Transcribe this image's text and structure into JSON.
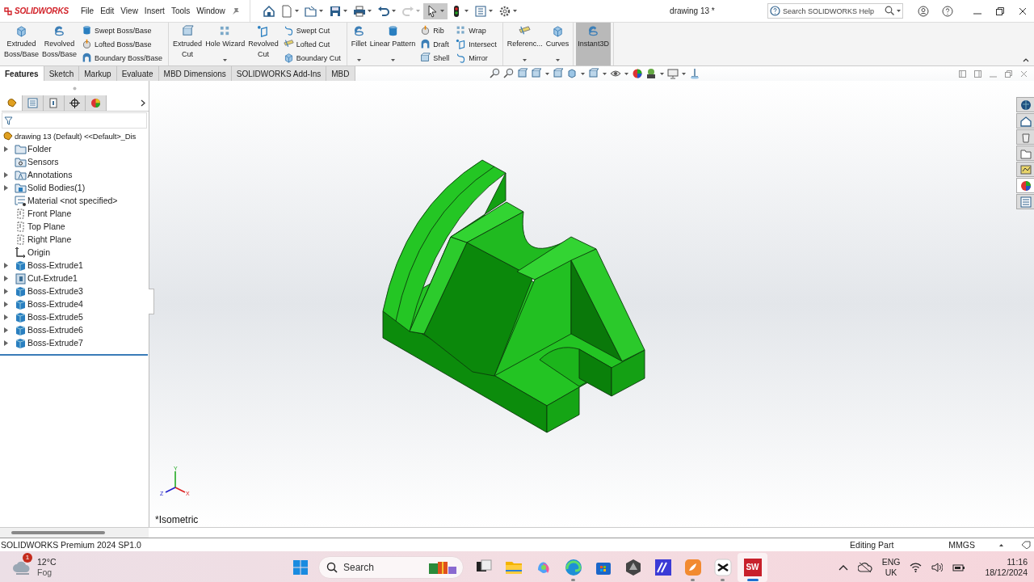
{
  "app": {
    "logo": "SOLIDWORKS",
    "menus": [
      "File",
      "Edit",
      "View",
      "Insert",
      "Tools",
      "Window"
    ],
    "title": "drawing 13 *",
    "search": {
      "placeholder": "Search SOLIDWORKS Help"
    }
  },
  "quick_toolbar": [
    {
      "selected": false,
      "disabled": false
    },
    {
      "selected": false,
      "disabled": false
    },
    {
      "selected": false,
      "disabled": false
    },
    {
      "selected": false,
      "disabled": false
    },
    {
      "selected": false,
      "disabled": false
    },
    {
      "selected": false,
      "disabled": false
    },
    {
      "selected": false,
      "disabled": true
    },
    {
      "selected": true,
      "disabled": false
    },
    {
      "selected": false,
      "disabled": false
    },
    {
      "selected": false,
      "disabled": false
    },
    {
      "selected": false,
      "disabled": false
    }
  ],
  "ribbon": {
    "groups": [
      {
        "items": [
          {
            "kind": "large",
            "label": "Extruded Boss/Base",
            "dropdown": false,
            "on": false
          },
          {
            "kind": "large",
            "label": "Revolved Boss/Base",
            "dropdown": false,
            "on": false
          },
          {
            "kind": "stack",
            "items": [
              "Swept Boss/Base",
              "Lofted Boss/Base",
              "Boundary Boss/Base"
            ]
          }
        ]
      },
      {
        "items": [
          {
            "kind": "large",
            "label": "Extruded Cut",
            "dropdown": false,
            "on": false
          },
          {
            "kind": "large",
            "label": "Hole Wizard",
            "dropdown": true,
            "on": false
          },
          {
            "kind": "large",
            "label": "Revolved Cut",
            "dropdown": false,
            "on": false
          },
          {
            "kind": "stack",
            "items": [
              "Swept Cut",
              "Lofted Cut",
              "Boundary Cut"
            ]
          }
        ]
      },
      {
        "items": [
          {
            "kind": "large",
            "label": "Fillet",
            "dropdown": true,
            "on": false
          },
          {
            "kind": "large",
            "label": "Linear Pattern",
            "dropdown": true,
            "on": false
          },
          {
            "kind": "stack",
            "items": [
              "Rib",
              "Draft",
              "Shell"
            ]
          },
          {
            "kind": "stack",
            "items": [
              "Wrap",
              "Intersect",
              "Mirror"
            ]
          }
        ]
      },
      {
        "items": [
          {
            "kind": "large",
            "label": "Referenc...",
            "dropdown": true,
            "on": false
          },
          {
            "kind": "large",
            "label": "Curves",
            "dropdown": true,
            "on": false
          }
        ]
      },
      {
        "items": [
          {
            "kind": "large",
            "label": "Instant3D",
            "dropdown": false,
            "on": true
          }
        ]
      }
    ]
  },
  "tabs": [
    {
      "label": "Features",
      "selected": true
    },
    {
      "label": "Sketch",
      "selected": false
    },
    {
      "label": "Markup",
      "selected": false
    },
    {
      "label": "Evaluate",
      "selected": false
    },
    {
      "label": "MBD Dimensions",
      "selected": false
    },
    {
      "label": "SOLIDWORKS Add-Ins",
      "selected": false
    },
    {
      "label": "MBD",
      "selected": false
    }
  ],
  "panel_tabs": [
    {
      "selected": true
    },
    {
      "selected": false
    },
    {
      "selected": false
    },
    {
      "selected": false
    },
    {
      "selected": false
    }
  ],
  "task_pane": [
    {
      "selected": false
    },
    {
      "selected": false
    },
    {
      "selected": false
    },
    {
      "selected": false
    },
    {
      "selected": false
    },
    {
      "selected": true
    },
    {
      "selected": false
    }
  ],
  "tree": {
    "root": "drawing 13 (Default) <<Default>_Dis",
    "items": [
      {
        "label": "Folder",
        "kind": "folder",
        "expandable": true
      },
      {
        "label": "Sensors",
        "kind": "sensors",
        "expandable": false
      },
      {
        "label": "Annotations",
        "kind": "annotations",
        "expandable": true
      },
      {
        "label": "Solid Bodies(1)",
        "kind": "bodies",
        "expandable": true
      },
      {
        "label": "Material <not specified>",
        "kind": "material",
        "expandable": false
      },
      {
        "label": "Front Plane",
        "kind": "plane",
        "expandable": false
      },
      {
        "label": "Top Plane",
        "kind": "plane",
        "expandable": false
      },
      {
        "label": "Right Plane",
        "kind": "plane",
        "expandable": false
      },
      {
        "label": "Origin",
        "kind": "origin",
        "expandable": false
      },
      {
        "label": "Boss-Extrude1",
        "kind": "boss",
        "expandable": true
      },
      {
        "label": "Cut-Extrude1",
        "kind": "cut",
        "expandable": true
      },
      {
        "label": "Boss-Extrude3",
        "kind": "boss",
        "expandable": true
      },
      {
        "label": "Boss-Extrude4",
        "kind": "boss",
        "expandable": true
      },
      {
        "label": "Boss-Extrude5",
        "kind": "boss",
        "expandable": true
      },
      {
        "label": "Boss-Extrude6",
        "kind": "boss",
        "expandable": true
      },
      {
        "label": "Boss-Extrude7",
        "kind": "boss",
        "expandable": true
      }
    ]
  },
  "viewport": {
    "view_label": "*Isometric",
    "triad": {
      "y": "Y",
      "z": "Z",
      "x": "X"
    }
  },
  "status_bar": {
    "product": "SOLIDWORKS Premium 2024 SP1.0",
    "mode": "Editing Part",
    "units": "MMGS"
  },
  "taskbar": {
    "weather": {
      "temperature": "12°C",
      "condition": "Fog",
      "badge": "1"
    },
    "search": {
      "placeholder": "Search"
    },
    "apps": [
      {
        "running": false,
        "selected": false
      },
      {
        "running": false,
        "selected": false
      },
      {
        "running": false,
        "selected": false
      },
      {
        "running": true,
        "selected": false
      },
      {
        "running": false,
        "selected": false
      },
      {
        "running": false,
        "selected": false
      },
      {
        "running": false,
        "selected": false
      },
      {
        "running": true,
        "selected": false
      },
      {
        "running": true,
        "selected": false
      },
      {
        "running": true,
        "selected": true,
        "label": "SW"
      }
    ],
    "language": "ENG",
    "region": "UK",
    "time": "11:16",
    "date": "18/12/2024"
  }
}
